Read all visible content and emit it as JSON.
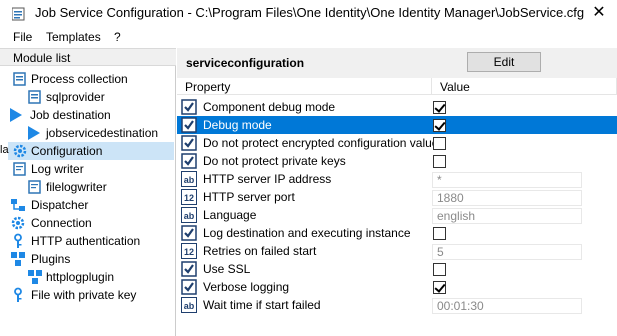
{
  "window": {
    "title": "Job Service Configuration - C:\\Program Files\\One Identity\\One Identity Manager\\JobService.cfg",
    "close_glyph": "✕"
  },
  "menu": [
    "File",
    "Templates",
    "?"
  ],
  "left_panel": {
    "header": "Module list",
    "edge_text": "la",
    "items": [
      {
        "label": "Process collection",
        "icon": "process-collection-icon",
        "level": 0
      },
      {
        "label": "sqlprovider",
        "icon": "sql-provider-icon",
        "level": 1
      },
      {
        "label": "Job destination",
        "icon": "job-destination-icon",
        "level": 0
      },
      {
        "label": "jobservicedestination",
        "icon": "job-destination-icon",
        "level": 1
      },
      {
        "label": "Configuration",
        "icon": "configuration-icon",
        "level": 0,
        "selected": true
      },
      {
        "label": "Log writer",
        "icon": "log-writer-icon",
        "level": 0
      },
      {
        "label": "filelogwriter",
        "icon": "log-writer-icon",
        "level": 1
      },
      {
        "label": "Dispatcher",
        "icon": "dispatcher-icon",
        "level": 0
      },
      {
        "label": "Connection",
        "icon": "connection-icon",
        "level": 0
      },
      {
        "label": "HTTP authentication",
        "icon": "key-icon",
        "level": 0
      },
      {
        "label": "Plugins",
        "icon": "plugins-icon",
        "level": 0
      },
      {
        "label": "httplogplugin",
        "icon": "plugins-icon",
        "level": 1
      },
      {
        "label": "File with private key",
        "icon": "key-icon",
        "level": 0
      }
    ]
  },
  "right_panel": {
    "title": "serviceconfiguration",
    "edit_label": "Edit",
    "columns": [
      "Property",
      "Value"
    ],
    "rows": [
      {
        "name": "Component debug mode",
        "type": "bool",
        "checked": true,
        "value": ""
      },
      {
        "name": "Debug mode",
        "type": "bool",
        "checked": true,
        "value": "",
        "selected": true
      },
      {
        "name": "Do not protect encrypted configuration values",
        "type": "bool",
        "checked": false,
        "value": ""
      },
      {
        "name": "Do not protect private keys",
        "type": "bool",
        "checked": false,
        "value": ""
      },
      {
        "name": "HTTP server IP address",
        "type": "text",
        "value": "*"
      },
      {
        "name": "HTTP server port",
        "type": "number",
        "value": "1880"
      },
      {
        "name": "Language",
        "type": "text",
        "value": "english"
      },
      {
        "name": "Log destination and executing instance",
        "type": "bool",
        "checked": false,
        "value": ""
      },
      {
        "name": "Retries on failed start",
        "type": "number",
        "value": "5"
      },
      {
        "name": "Use SSL",
        "type": "bool",
        "checked": false,
        "value": ""
      },
      {
        "name": "Verbose logging",
        "type": "bool",
        "checked": true,
        "value": ""
      },
      {
        "name": "Wait time if start failed",
        "type": "text",
        "value": "00:01:30"
      }
    ]
  }
}
